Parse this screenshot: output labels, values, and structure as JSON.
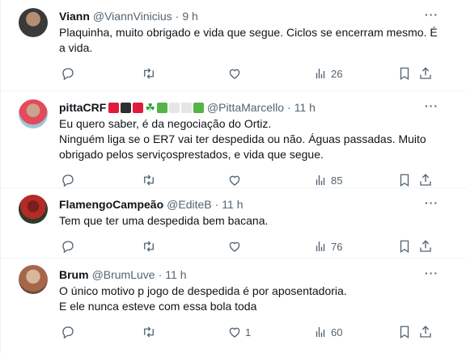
{
  "tweets": [
    {
      "name": "Viann",
      "handle": "@ViannVinicius",
      "dot": "·",
      "time": "9 h",
      "more": "···",
      "lines": [
        "Plaquinha, muito obrigado e vida que segue. Ciclos se encerram mesmo. É",
        "a vida."
      ],
      "replies": "",
      "retweets": "",
      "likes": "",
      "views": "26"
    },
    {
      "name": "pittaCRF",
      "name_emojis": [
        "red-square",
        "black-square",
        "red-square",
        "shamrock",
        "green-square",
        "white-square",
        "white-square",
        "green-square"
      ],
      "handle": "@PittaMarcello",
      "dot": "·",
      "time": "11 h",
      "more": "···",
      "lines": [
        "Eu quero saber, é da negociação do Ortiz.",
        "Ninguém liga se o ER7 vai ter despedida ou não. Águas passadas. Muito",
        "obrigado pelos serviçosprestados, e vida que segue."
      ],
      "replies": "",
      "retweets": "",
      "likes": "",
      "views": "85"
    },
    {
      "name": "FlamengoCampeão",
      "handle": "@EditeB",
      "dot": "·",
      "time": "11 h",
      "more": "···",
      "lines": [
        "Tem que ter uma despedida  bem bacana."
      ],
      "replies": "",
      "retweets": "",
      "likes": "",
      "views": "76"
    },
    {
      "name": "Brum",
      "handle": "@BrumLuve",
      "dot": "·",
      "time": "11 h",
      "more": "···",
      "lines": [
        "O único motivo p jogo de despedida é por aposentadoria.",
        "E ele nunca esteve com essa bola toda"
      ],
      "replies": "",
      "retweets": "",
      "likes": "1",
      "views": "60"
    }
  ],
  "icons": {
    "reply": "reply-icon",
    "retweet": "retweet-icon",
    "like": "heart-icon",
    "views": "views-chart-icon",
    "bookmark": "bookmark-icon",
    "share": "share-icon"
  },
  "colors": {
    "text": "#0f1419",
    "secondary": "#536471",
    "divider": "#eff3f4"
  }
}
